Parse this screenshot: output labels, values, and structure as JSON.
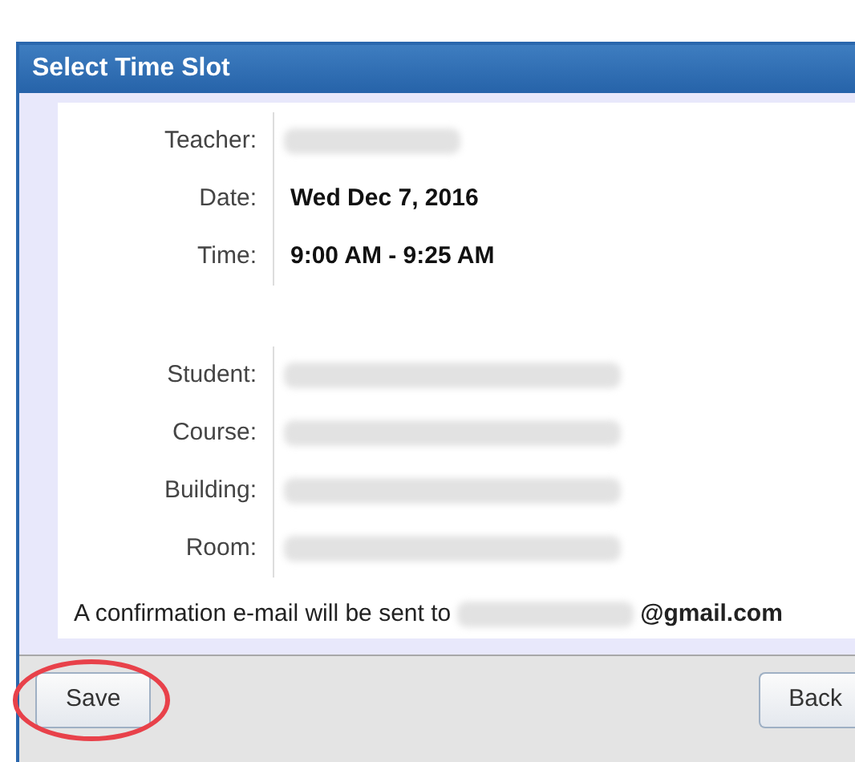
{
  "dialog": {
    "title": "Select Time Slot"
  },
  "groups": [
    [
      {
        "label": "Teacher:",
        "redacted": true
      },
      {
        "label": "Date:",
        "value": "Wed Dec 7, 2016",
        "redacted": false
      },
      {
        "label": "Time:",
        "value": "9:00 AM - 9:25 AM",
        "redacted": false
      }
    ],
    [
      {
        "label": "Student:",
        "redacted": true
      },
      {
        "label": "Course:",
        "redacted": true
      },
      {
        "label": "Building:",
        "redacted": true
      },
      {
        "label": "Room:",
        "redacted": true
      }
    ]
  ],
  "confirmation": {
    "text": "A confirmation e-mail will be sent to",
    "email_redacted": true,
    "email_domain": "@gmail.com"
  },
  "buttons": [
    {
      "label": "Save",
      "highlighted": true
    },
    {
      "label": "Back",
      "highlighted": false
    }
  ]
}
